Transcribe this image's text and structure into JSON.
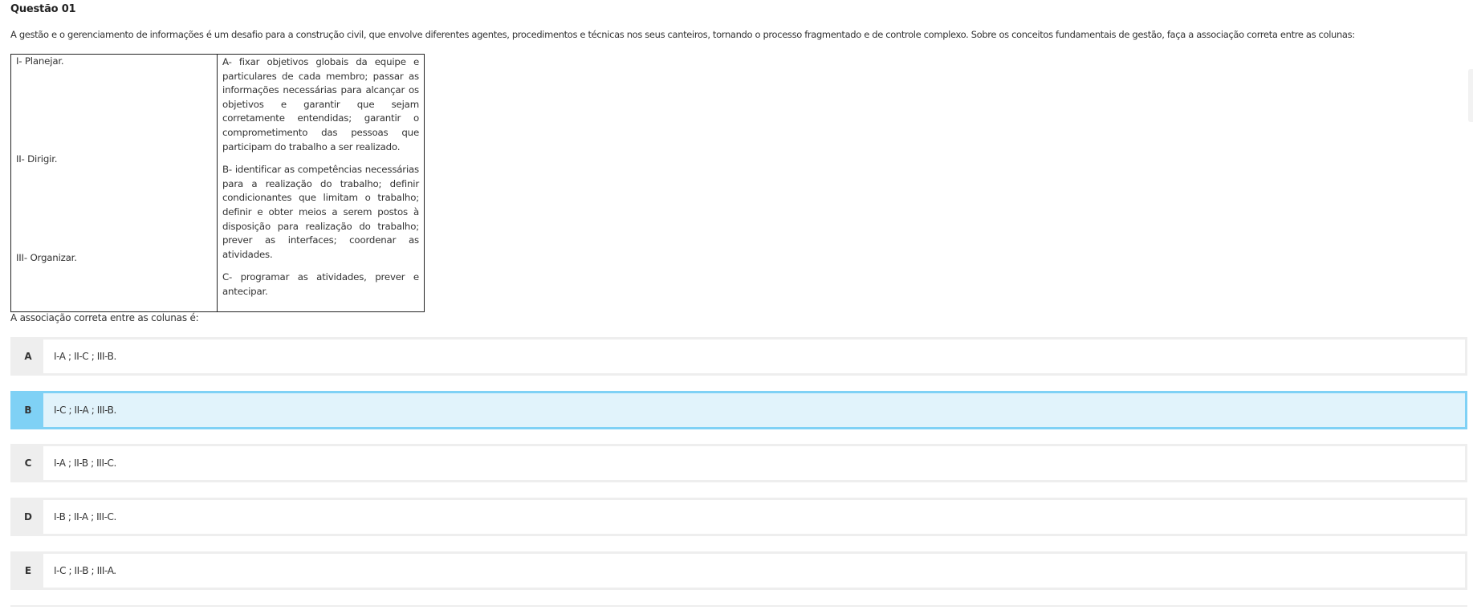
{
  "question": {
    "title": "Questão 01",
    "statement": "A gestão e o gerenciamento de informações é um desafio para a construção civil, que envolve diferentes agentes, procedimentos e técnicas nos seus canteiros, tornando o processo fragmentado e de controle complexo. Sobre os conceitos fundamentais de gestão, faça a associação correta entre as colunas:",
    "left_column": [
      "I- Planejar.",
      "II- Dirigir.",
      "III- Organizar."
    ],
    "right_column": [
      "A- fixar objetivos globais da equipe e particulares de cada membro; passar as informações necessárias para alcançar os objetivos e garantir que sejam corretamente entendidas; garantir o comprometimento das pessoas que participam do trabalho a ser realizado.",
      "B- identificar as competências necessárias para a realização do trabalho; definir condicionantes que limitam o trabalho; definir e obter meios a serem postos à disposição para realização do trabalho; prever as interfaces; coordenar as atividades.",
      "C- programar as atividades, prever e antecipar."
    ],
    "prompt": "A associação correta entre as colunas é:"
  },
  "alternatives": [
    {
      "letter": "A",
      "text": "I-A ; II-C ; III-B."
    },
    {
      "letter": "B",
      "text": "I-C ; II-A ; III-B."
    },
    {
      "letter": "C",
      "text": "I-A ; II-B ; III-C."
    },
    {
      "letter": "D",
      "text": "I-B ; II-A ; III-C."
    },
    {
      "letter": "E",
      "text": "I-C ; II-B ; III-A."
    }
  ],
  "selected_alternative": "B",
  "colors": {
    "selected_border": "#7fd1f5",
    "selected_background": "#e1f3fb",
    "unselected_border": "#eeeeee"
  }
}
